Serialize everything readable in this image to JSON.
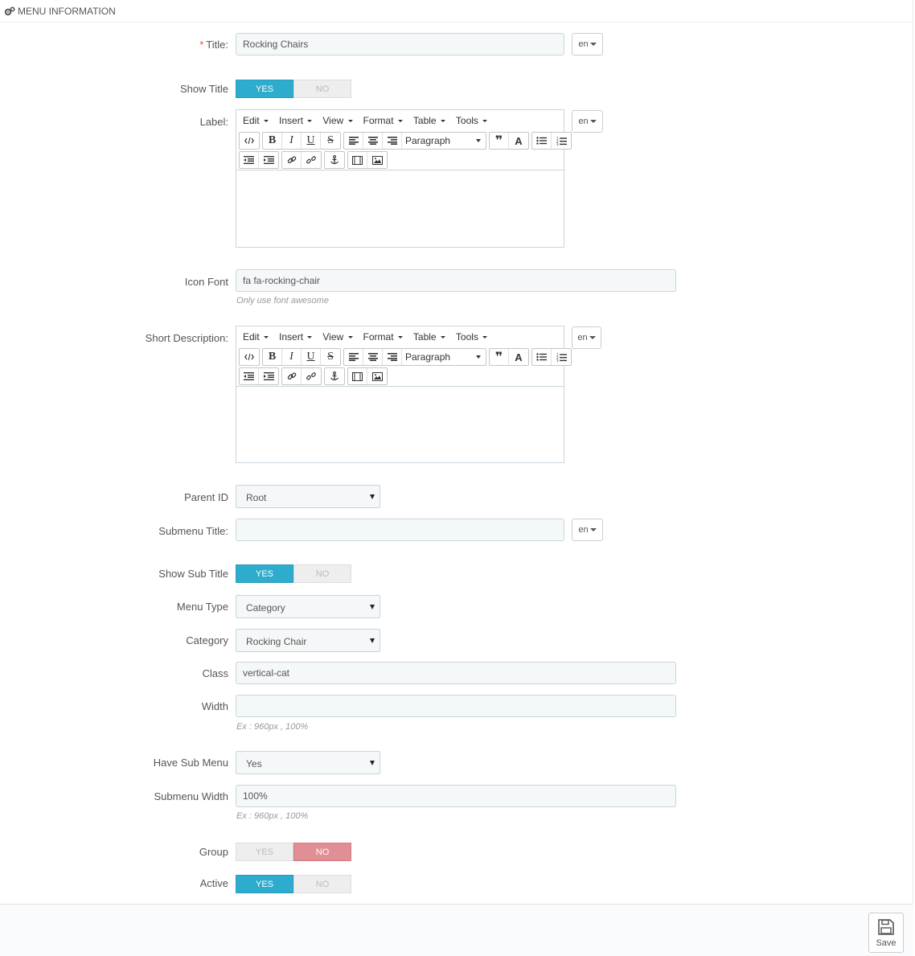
{
  "heading": "MENU INFORMATION",
  "fields": {
    "title": {
      "label": "Title:",
      "required_mark": "*",
      "value": "Rocking Chairs",
      "lang": "en"
    },
    "show_title": {
      "label": "Show Title",
      "yes": "YES",
      "no": "NO",
      "selected": "YES"
    },
    "label": {
      "label": "Label:",
      "lang": "en"
    },
    "icon_font": {
      "label": "Icon Font",
      "value": "fa fa-rocking-chair",
      "help": "Only use font awesome"
    },
    "short_description": {
      "label": "Short Description:",
      "lang": "en"
    },
    "parent_id": {
      "label": "Parent ID",
      "value": "Root"
    },
    "submenu_title": {
      "label": "Submenu Title:",
      "value": "",
      "lang": "en"
    },
    "show_sub_title": {
      "label": "Show Sub Title",
      "yes": "YES",
      "no": "NO",
      "selected": "YES"
    },
    "menu_type": {
      "label": "Menu Type",
      "value": "Category"
    },
    "category": {
      "label": "Category",
      "value": "Rocking Chair"
    },
    "class": {
      "label": "Class",
      "value": "vertical-cat"
    },
    "width": {
      "label": "Width",
      "value": "",
      "help": "Ex : 960px , 100%"
    },
    "have_sub_menu": {
      "label": "Have Sub Menu",
      "value": "Yes"
    },
    "submenu_width": {
      "label": "Submenu Width",
      "value": "100%",
      "help": "Ex : 960px , 100%"
    },
    "group": {
      "label": "Group",
      "yes": "YES",
      "no": "NO",
      "selected": "NO"
    },
    "active": {
      "label": "Active",
      "yes": "YES",
      "no": "NO",
      "selected": "YES"
    }
  },
  "editor": {
    "menus": [
      "Edit",
      "Insert",
      "View",
      "Format",
      "Table",
      "Tools"
    ],
    "block_format": "Paragraph"
  },
  "footer": {
    "save_label": "Save"
  },
  "colors": {
    "switch_yes": "#2eacce",
    "switch_no": "#e08f95",
    "required": "#e74c3c"
  }
}
